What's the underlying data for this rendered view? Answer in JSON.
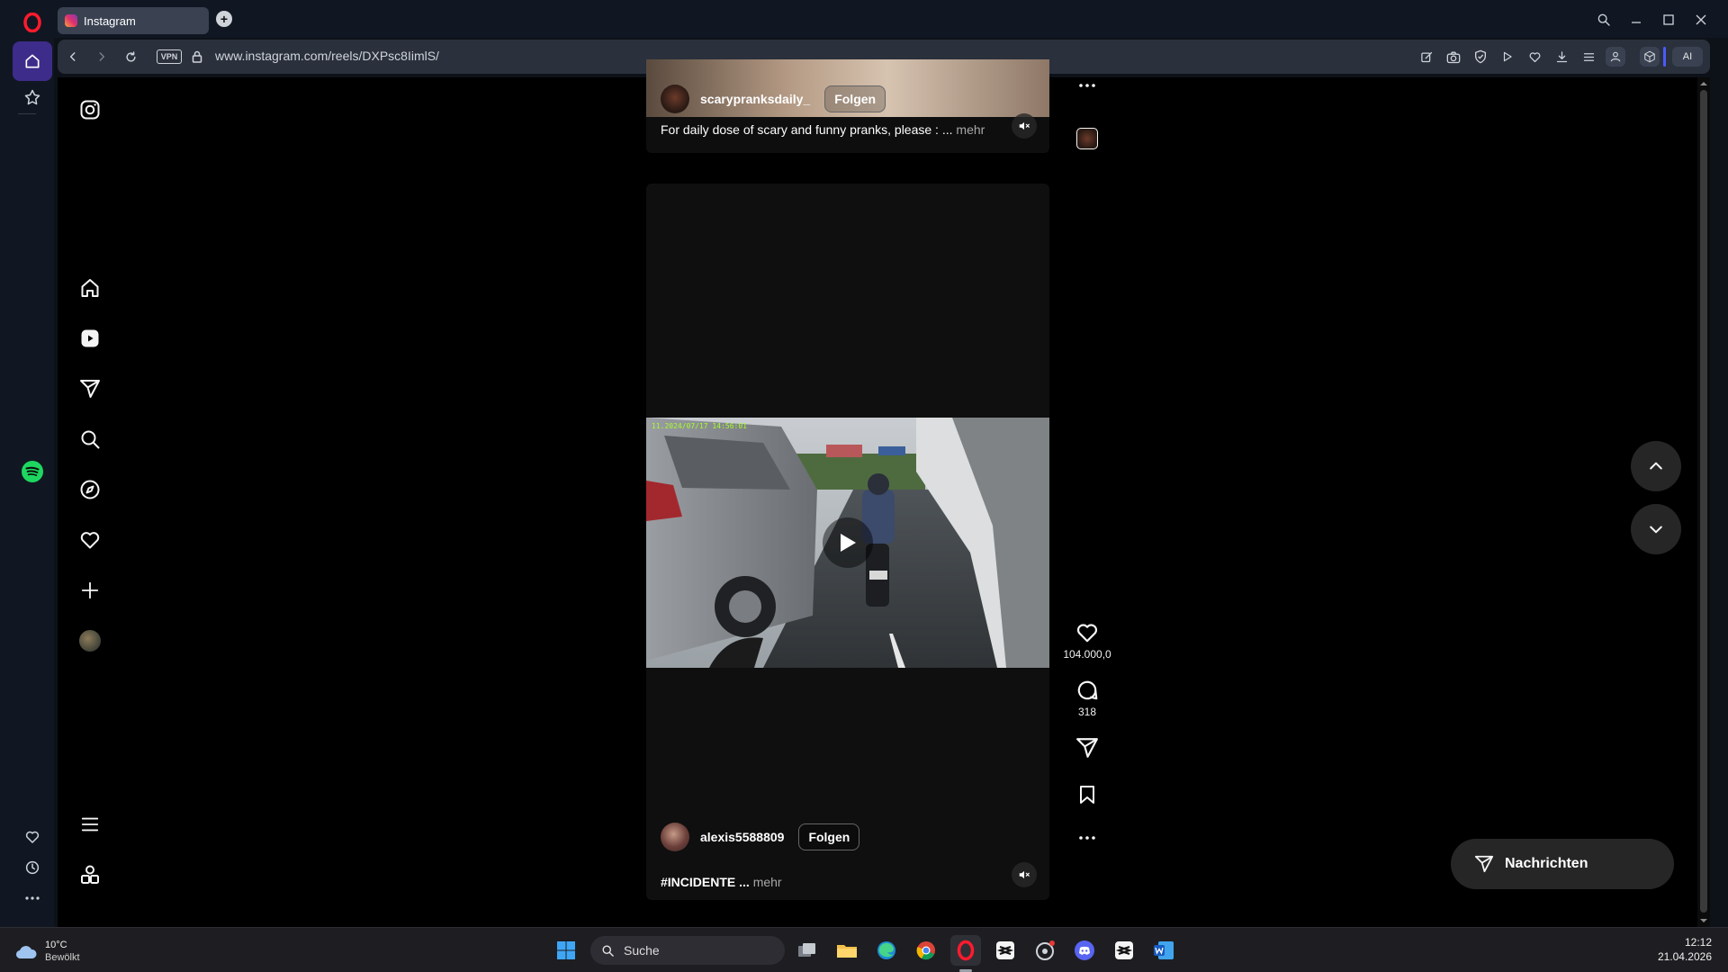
{
  "browser": {
    "tab_title": "Instagram",
    "url": "www.instagram.com/reels/DXPsc8IimlS/",
    "vpn_label": "VPN",
    "ai_label": "AI"
  },
  "reels": {
    "top": {
      "username": "scarypranksdaily_",
      "follow_label": "Folgen",
      "caption": "For daily dose of scary and funny pranks, please : ...",
      "more_label": "mehr"
    },
    "main": {
      "video_timestamp": "11.2024/07/17 14:56:01",
      "username": "alexis5588809",
      "follow_label": "Folgen",
      "caption": "#INCIDENTE ...",
      "more_label": "mehr",
      "likes": "104.000,0",
      "comments": "318"
    }
  },
  "messages": {
    "label": "Nachrichten"
  },
  "taskbar": {
    "weather_temp": "10°C",
    "weather_desc": "Bewölkt",
    "search_placeholder": "Suche",
    "time": "12:12",
    "date": "21.04.2026"
  }
}
